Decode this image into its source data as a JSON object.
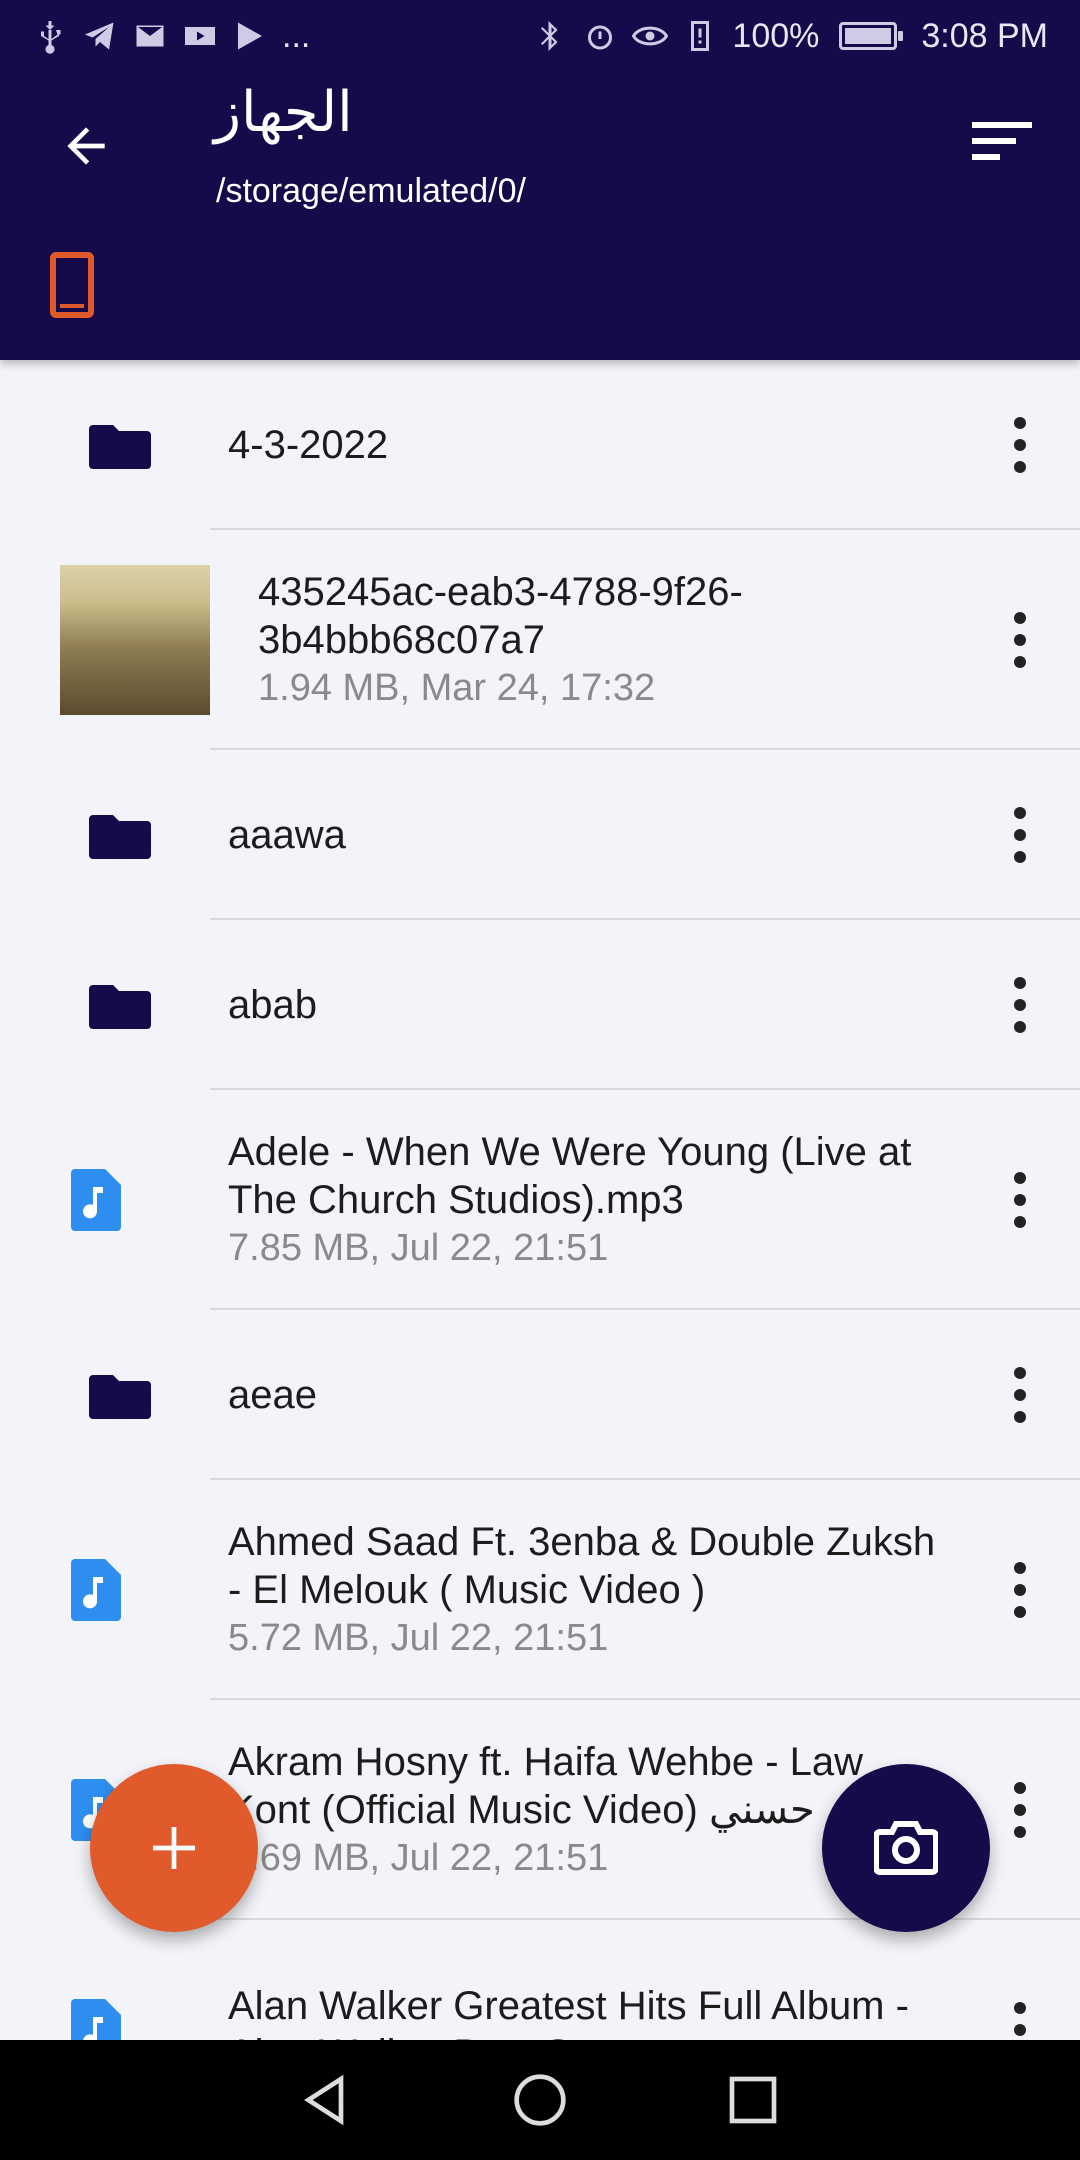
{
  "status_bar": {
    "battery": "100%",
    "time": "3:08 PM",
    "more": "..."
  },
  "header": {
    "title": "الجهاز",
    "path": "/storage/emulated/0/"
  },
  "files": [
    {
      "type": "folder",
      "name": "4-3-2022",
      "meta": ""
    },
    {
      "type": "image",
      "name": "435245ac-eab3-4788-9f26-3b4bbb68c07a7",
      "meta": "1.94 MB, Mar 24, 17:32"
    },
    {
      "type": "folder",
      "name": "aaawa",
      "meta": ""
    },
    {
      "type": "folder",
      "name": "abab",
      "meta": ""
    },
    {
      "type": "audio",
      "name": "Adele - When We Were Young (Live at The Church Studios).mp3",
      "meta": "7.85 MB, Jul 22, 21:51"
    },
    {
      "type": "folder",
      "name": "aeae",
      "meta": ""
    },
    {
      "type": "audio",
      "name": "Ahmed Saad Ft. 3enba & Double Zuksh - El Melouk ( Music Video )",
      "meta": "5.72 MB, Jul 22, 21:51"
    },
    {
      "type": "audio",
      "name": "Akram Hosny ft. Haifa Wehbe - Law Kont (Official Music Video) حسني",
      "meta": "3.69 MB, Jul 22, 21:51"
    },
    {
      "type": "audio",
      "name": "Alan Walker Greatest Hits Full Album - Alan Walker Best Songs",
      "meta": ""
    }
  ],
  "colors": {
    "primary": "#170a4a",
    "accent": "#e05a2b",
    "file_icon": "#2e8ef0",
    "background": "#f3f4f9"
  },
  "icons": {
    "back": "arrow-left-icon",
    "sort": "sort-icon",
    "device": "phone-icon",
    "folder": "folder-icon",
    "audio": "music-file-icon",
    "more": "more-vert-icon",
    "add": "plus-icon",
    "camera": "camera-icon"
  }
}
